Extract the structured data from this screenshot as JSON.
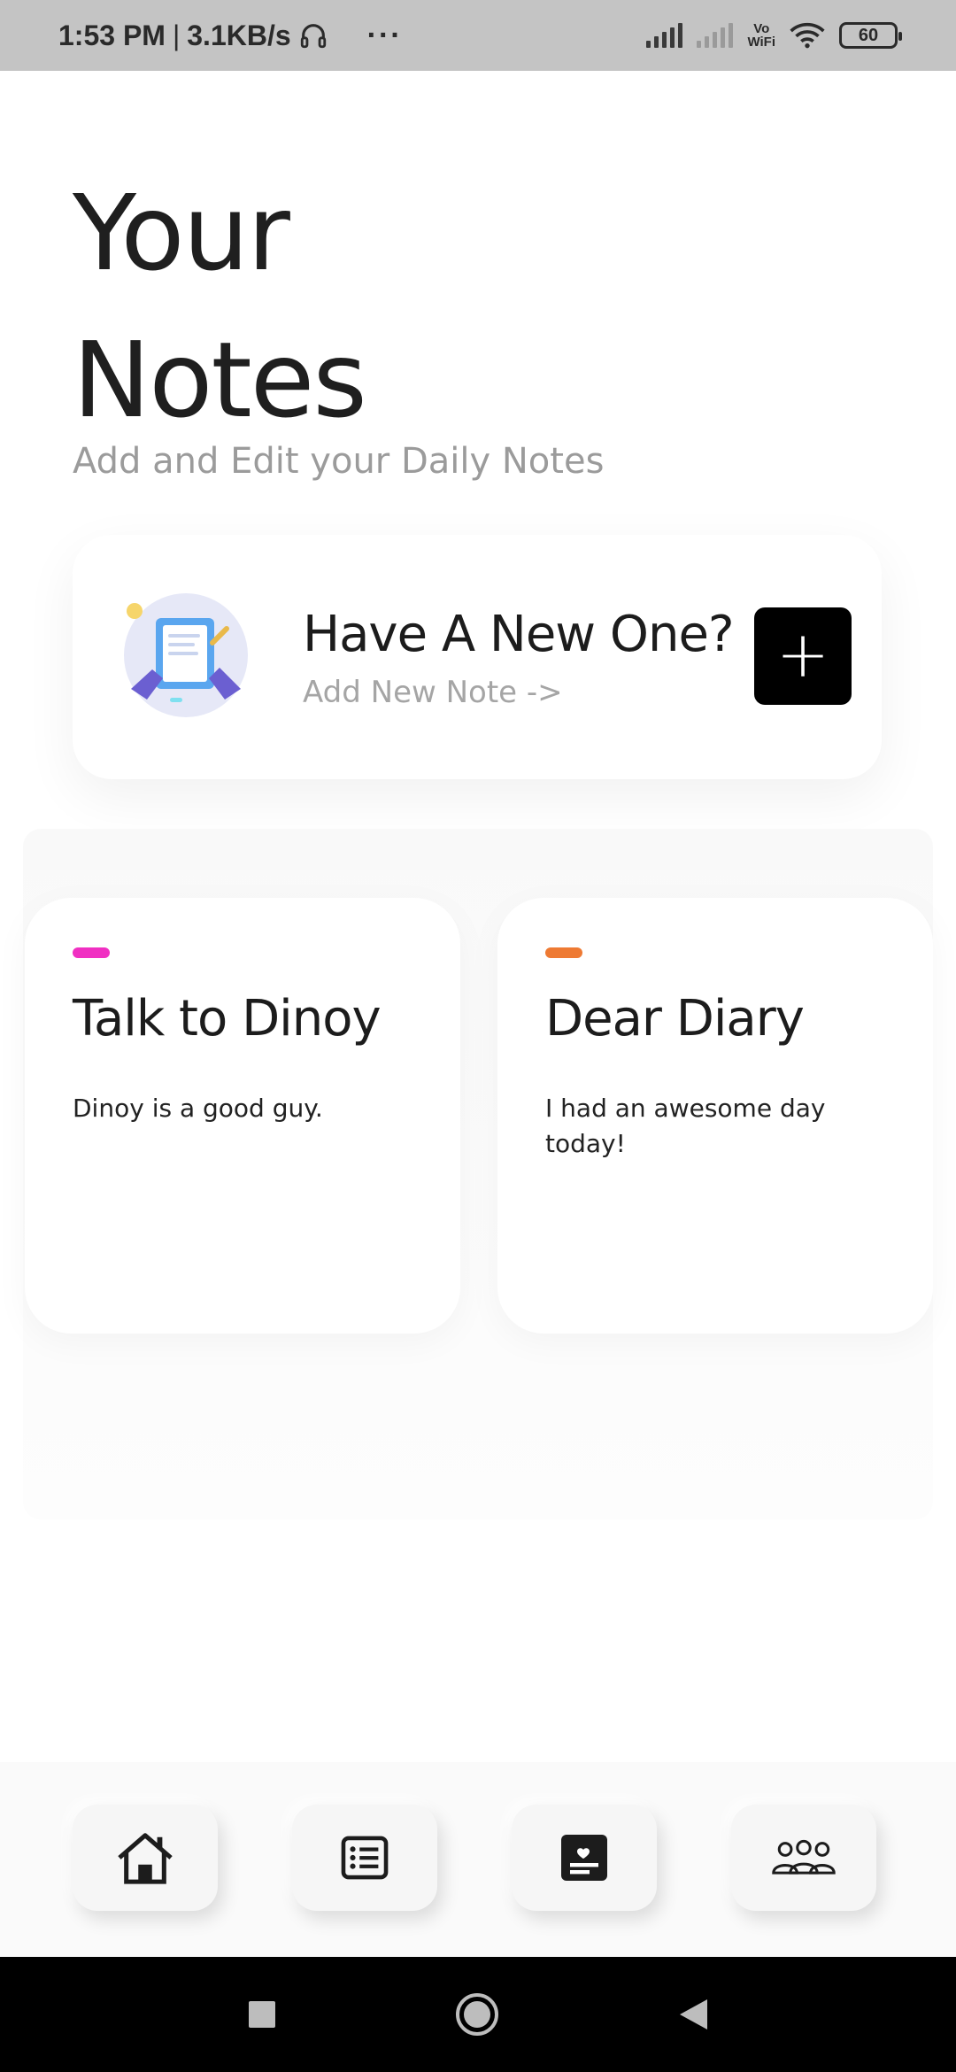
{
  "status_bar": {
    "time": "1:53 PM",
    "separator": "|",
    "speed": "3.1KB/s",
    "dots": "···",
    "vo": "Vo",
    "wifi_label": "WiFi",
    "battery": "60"
  },
  "header": {
    "title_line1": "Your",
    "title_line2": "Notes",
    "subtitle": "Add and Edit your Daily Notes"
  },
  "new_note_card": {
    "title": "Have A New One?",
    "link": "Add New Note  ->",
    "add_symbol": "+"
  },
  "notes": [
    {
      "title": "Talk to Dinoy",
      "body": "Dinoy is a good guy.",
      "accent_color": "#f02fc2"
    },
    {
      "title": "Dear Diary",
      "body": "I had an awesome day today!",
      "accent_color": "#ee7a33"
    }
  ],
  "bottom_nav": {
    "items": [
      {
        "icon": "home-icon"
      },
      {
        "icon": "list-icon"
      },
      {
        "icon": "favorite-note-icon"
      },
      {
        "icon": "group-icon"
      }
    ]
  }
}
